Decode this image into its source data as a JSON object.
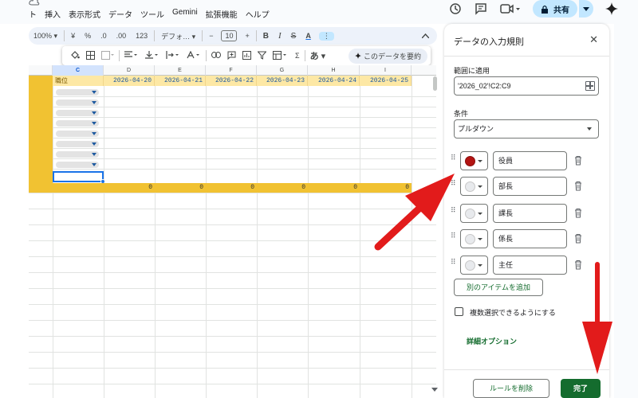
{
  "menubar": {
    "items": [
      "ト",
      "挿入",
      "表示形式",
      "データ",
      "ツール",
      "Gemini",
      "拡張機能",
      "ヘルプ"
    ],
    "share_label": "共有"
  },
  "toolbar": {
    "zoom": "100%",
    "currency": "¥",
    "percent": "%",
    "dec_minus": ".0",
    "dec_plus": ".00",
    "number_format": "123",
    "font": "デフォ…",
    "minus": "−",
    "font_size": "10",
    "plus": "+",
    "bold": "B",
    "italic": "I",
    "strike": "S",
    "text_color": "A",
    "more": "⋮"
  },
  "float_toolbar": {
    "summarize_label": "このデータを要約",
    "sigma": "Σ",
    "kana": "あ"
  },
  "sheet": {
    "columns": [
      "C",
      "D",
      "E",
      "F",
      "G",
      "H",
      "I"
    ],
    "header_c": "職位",
    "dates": [
      "2026-04-20",
      "2026-04-21",
      "2026-04-22",
      "2026-04-23",
      "2026-04-24",
      "2026-04-25"
    ],
    "totals": [
      "0",
      "0",
      "0",
      "0",
      "0",
      "0"
    ]
  },
  "panel": {
    "title": "データの入力規則",
    "range_label": "範囲に適用",
    "range_value": "'2026_02'!C2:C9",
    "condition_label": "条件",
    "condition_value": "プルダウン",
    "options": [
      {
        "value": "役員",
        "color": "#b31412"
      },
      {
        "value": "部長",
        "color": "#e8eaed"
      },
      {
        "value": "課長",
        "color": "#e8eaed"
      },
      {
        "value": "係長",
        "color": "#e8eaed"
      },
      {
        "value": "主任",
        "color": "#e8eaed"
      }
    ],
    "add_item_label": "別のアイテムを追加",
    "multi_select_label": "複数選択できるようにする",
    "advanced_label": "詳細オプション",
    "remove_rule_label": "ルールを削除",
    "done_label": "完了"
  },
  "colors": {
    "accent_green": "#146c2e",
    "header_yellow": "#fde8a5",
    "dark_yellow": "#f1c232",
    "arrow_red": "#e21b1b",
    "selection_blue": "#1a73e8"
  }
}
